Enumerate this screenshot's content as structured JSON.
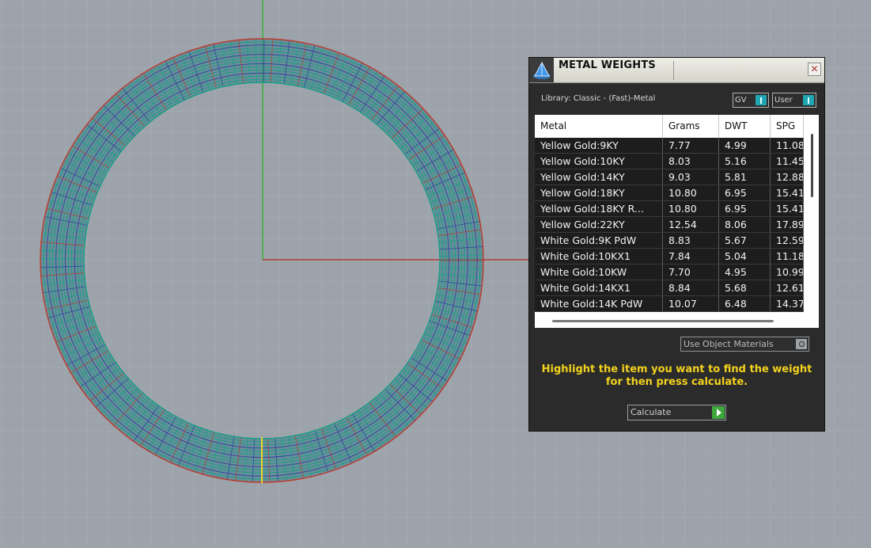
{
  "panel": {
    "title": "METAL WEIGHTS",
    "close_glyph": "✕",
    "library_label": "Library: Classic - (Fast)-Metal",
    "toggles": [
      {
        "label": "GV",
        "state": "on"
      },
      {
        "label": "User",
        "state": "on"
      }
    ],
    "table": {
      "columns": [
        "Metal",
        "Grams",
        "DWT",
        "SPG"
      ],
      "rows": [
        {
          "metal": "Yellow Gold:9KY",
          "grams": "7.77",
          "dwt": "4.99",
          "spg": "11.08"
        },
        {
          "metal": "Yellow Gold:10KY",
          "grams": "8.03",
          "dwt": "5.16",
          "spg": "11.45"
        },
        {
          "metal": "Yellow Gold:14KY",
          "grams": "9.03",
          "dwt": "5.81",
          "spg": "12.88"
        },
        {
          "metal": "Yellow Gold:18KY",
          "grams": "10.80",
          "dwt": "6.95",
          "spg": "15.41"
        },
        {
          "metal": "Yellow Gold:18KY R...",
          "grams": "10.80",
          "dwt": "6.95",
          "spg": "15.41"
        },
        {
          "metal": "Yellow Gold:22KY",
          "grams": "12.54",
          "dwt": "8.06",
          "spg": "17.89"
        },
        {
          "metal": "White Gold:9K PdW",
          "grams": "8.83",
          "dwt": "5.67",
          "spg": "12.59"
        },
        {
          "metal": "White Gold:10KX1",
          "grams": "7.84",
          "dwt": "5.04",
          "spg": "11.18"
        },
        {
          "metal": "White Gold:10KW",
          "grams": "7.70",
          "dwt": "4.95",
          "spg": "10.99"
        },
        {
          "metal": "White Gold:14KX1",
          "grams": "8.84",
          "dwt": "5.68",
          "spg": "12.61"
        },
        {
          "metal": "White Gold:14K PdW",
          "grams": "10.07",
          "dwt": "6.48",
          "spg": "14.37"
        }
      ]
    },
    "use_object_materials_label": "Use Object Materials",
    "hint_line1": "Highlight the item you want to find the weight",
    "hint_line2": "for then press calculate.",
    "calculate_label": "Calculate"
  },
  "colors": {
    "viewport_bg": "#9da3ab",
    "x_axis": "#b03a2e",
    "y_axis": "#3bb03b",
    "ring_outline": "#c0392b",
    "ring_wire_a": "#16a085",
    "ring_wire_b": "#2c3e9e",
    "hint_text": "#f2d21e"
  },
  "icons": {
    "app_icon": "pyramid-icon",
    "close": "close-icon",
    "toggle_knob": "toggle-knob-icon",
    "play": "play-arrow-icon"
  }
}
